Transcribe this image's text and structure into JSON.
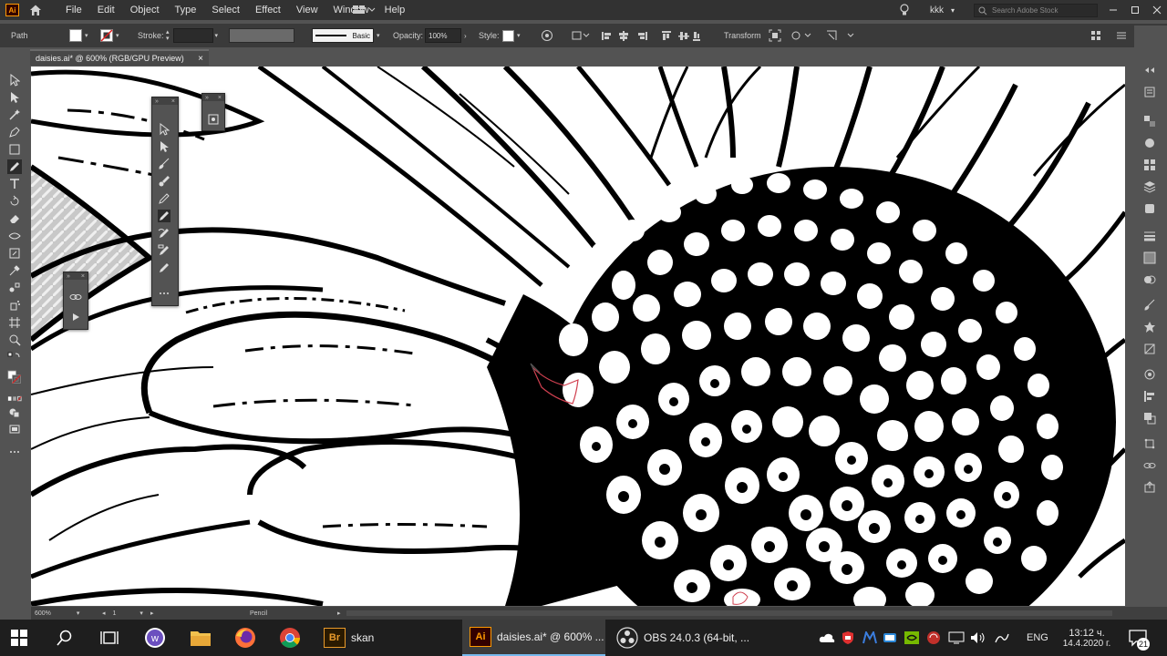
{
  "app": {
    "logo": "Ai"
  },
  "menu": {
    "items": [
      "File",
      "Edit",
      "Object",
      "Type",
      "Select",
      "Effect",
      "View",
      "Window",
      "Help"
    ],
    "user": "kkk",
    "search_placeholder": "Search Adobe Stock"
  },
  "control": {
    "selection_label": "Path",
    "stroke_label": "Stroke:",
    "brush_label": "Basic",
    "opacity_label": "Opacity:",
    "opacity_value": "100%",
    "style_label": "Style:",
    "transform_label": "Transform"
  },
  "document": {
    "tab_title": "daisies.ai* @ 600% (RGB/GPU Preview)",
    "close_symbol": "×"
  },
  "status": {
    "zoom": "600%",
    "artboard": "1",
    "tool": "Pencil"
  },
  "taskbar": {
    "apps": [
      {
        "name": "skan",
        "icon": "Br"
      },
      {
        "name": "daisies.ai* @ 600% ...",
        "icon": "Ai"
      },
      {
        "name": "OBS 24.0.3 (64-bit, ..."
      }
    ],
    "language": "ENG",
    "time": "13:12 ч.",
    "date": "14.4.2020 г.",
    "notifications": "21"
  },
  "colors": {
    "accent_ai": "#ff9a00",
    "ai_bg": "#330000",
    "br_bg": "#2a1a00",
    "br_fg": "#e89a2b",
    "pencil_path": "#d04050"
  },
  "icons": [
    "home-icon",
    "workspace-icon",
    "lightbulb-icon",
    "search-icon",
    "pencil-icon",
    "direct-select-icon",
    "windows-start-icon"
  ]
}
